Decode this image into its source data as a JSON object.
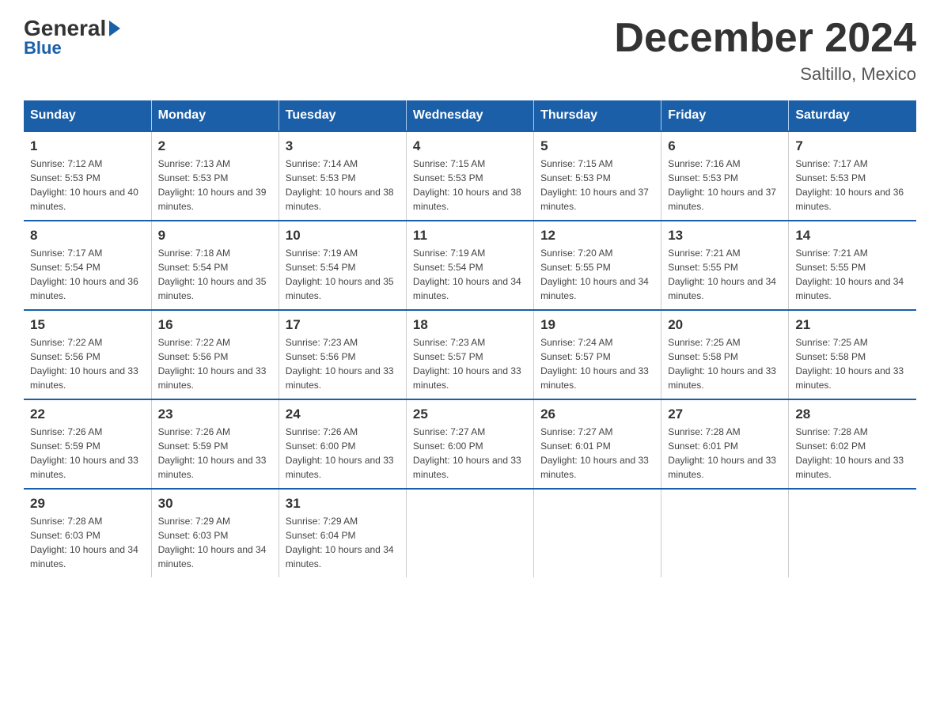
{
  "logo": {
    "general": "General",
    "blue": "Blue"
  },
  "header": {
    "month_title": "December 2024",
    "location": "Saltillo, Mexico"
  },
  "weekdays": [
    "Sunday",
    "Monday",
    "Tuesday",
    "Wednesday",
    "Thursday",
    "Friday",
    "Saturday"
  ],
  "weeks": [
    [
      {
        "day": "1",
        "sunrise": "7:12 AM",
        "sunset": "5:53 PM",
        "daylight": "10 hours and 40 minutes."
      },
      {
        "day": "2",
        "sunrise": "7:13 AM",
        "sunset": "5:53 PM",
        "daylight": "10 hours and 39 minutes."
      },
      {
        "day": "3",
        "sunrise": "7:14 AM",
        "sunset": "5:53 PM",
        "daylight": "10 hours and 38 minutes."
      },
      {
        "day": "4",
        "sunrise": "7:15 AM",
        "sunset": "5:53 PM",
        "daylight": "10 hours and 38 minutes."
      },
      {
        "day": "5",
        "sunrise": "7:15 AM",
        "sunset": "5:53 PM",
        "daylight": "10 hours and 37 minutes."
      },
      {
        "day": "6",
        "sunrise": "7:16 AM",
        "sunset": "5:53 PM",
        "daylight": "10 hours and 37 minutes."
      },
      {
        "day": "7",
        "sunrise": "7:17 AM",
        "sunset": "5:53 PM",
        "daylight": "10 hours and 36 minutes."
      }
    ],
    [
      {
        "day": "8",
        "sunrise": "7:17 AM",
        "sunset": "5:54 PM",
        "daylight": "10 hours and 36 minutes."
      },
      {
        "day": "9",
        "sunrise": "7:18 AM",
        "sunset": "5:54 PM",
        "daylight": "10 hours and 35 minutes."
      },
      {
        "day": "10",
        "sunrise": "7:19 AM",
        "sunset": "5:54 PM",
        "daylight": "10 hours and 35 minutes."
      },
      {
        "day": "11",
        "sunrise": "7:19 AM",
        "sunset": "5:54 PM",
        "daylight": "10 hours and 34 minutes."
      },
      {
        "day": "12",
        "sunrise": "7:20 AM",
        "sunset": "5:55 PM",
        "daylight": "10 hours and 34 minutes."
      },
      {
        "day": "13",
        "sunrise": "7:21 AM",
        "sunset": "5:55 PM",
        "daylight": "10 hours and 34 minutes."
      },
      {
        "day": "14",
        "sunrise": "7:21 AM",
        "sunset": "5:55 PM",
        "daylight": "10 hours and 34 minutes."
      }
    ],
    [
      {
        "day": "15",
        "sunrise": "7:22 AM",
        "sunset": "5:56 PM",
        "daylight": "10 hours and 33 minutes."
      },
      {
        "day": "16",
        "sunrise": "7:22 AM",
        "sunset": "5:56 PM",
        "daylight": "10 hours and 33 minutes."
      },
      {
        "day": "17",
        "sunrise": "7:23 AM",
        "sunset": "5:56 PM",
        "daylight": "10 hours and 33 minutes."
      },
      {
        "day": "18",
        "sunrise": "7:23 AM",
        "sunset": "5:57 PM",
        "daylight": "10 hours and 33 minutes."
      },
      {
        "day": "19",
        "sunrise": "7:24 AM",
        "sunset": "5:57 PM",
        "daylight": "10 hours and 33 minutes."
      },
      {
        "day": "20",
        "sunrise": "7:25 AM",
        "sunset": "5:58 PM",
        "daylight": "10 hours and 33 minutes."
      },
      {
        "day": "21",
        "sunrise": "7:25 AM",
        "sunset": "5:58 PM",
        "daylight": "10 hours and 33 minutes."
      }
    ],
    [
      {
        "day": "22",
        "sunrise": "7:26 AM",
        "sunset": "5:59 PM",
        "daylight": "10 hours and 33 minutes."
      },
      {
        "day": "23",
        "sunrise": "7:26 AM",
        "sunset": "5:59 PM",
        "daylight": "10 hours and 33 minutes."
      },
      {
        "day": "24",
        "sunrise": "7:26 AM",
        "sunset": "6:00 PM",
        "daylight": "10 hours and 33 minutes."
      },
      {
        "day": "25",
        "sunrise": "7:27 AM",
        "sunset": "6:00 PM",
        "daylight": "10 hours and 33 minutes."
      },
      {
        "day": "26",
        "sunrise": "7:27 AM",
        "sunset": "6:01 PM",
        "daylight": "10 hours and 33 minutes."
      },
      {
        "day": "27",
        "sunrise": "7:28 AM",
        "sunset": "6:01 PM",
        "daylight": "10 hours and 33 minutes."
      },
      {
        "day": "28",
        "sunrise": "7:28 AM",
        "sunset": "6:02 PM",
        "daylight": "10 hours and 33 minutes."
      }
    ],
    [
      {
        "day": "29",
        "sunrise": "7:28 AM",
        "sunset": "6:03 PM",
        "daylight": "10 hours and 34 minutes."
      },
      {
        "day": "30",
        "sunrise": "7:29 AM",
        "sunset": "6:03 PM",
        "daylight": "10 hours and 34 minutes."
      },
      {
        "day": "31",
        "sunrise": "7:29 AM",
        "sunset": "6:04 PM",
        "daylight": "10 hours and 34 minutes."
      },
      null,
      null,
      null,
      null
    ]
  ],
  "labels": {
    "sunrise_prefix": "Sunrise: ",
    "sunset_prefix": "Sunset: ",
    "daylight_prefix": "Daylight: "
  }
}
